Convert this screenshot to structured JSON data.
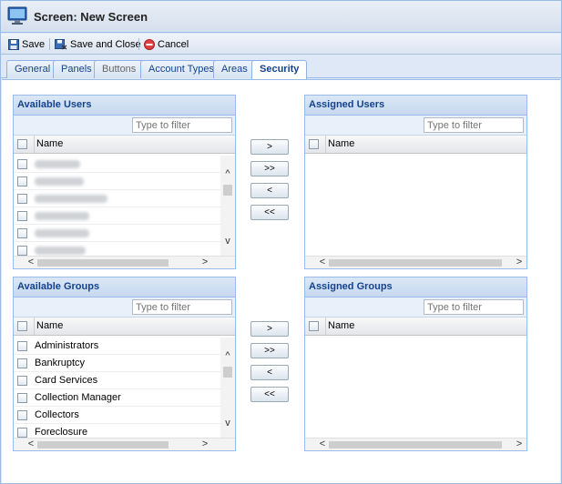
{
  "window": {
    "title": "Screen: New Screen"
  },
  "toolbar": {
    "save": "Save",
    "save_close": "Save and Close",
    "cancel": "Cancel"
  },
  "tabs": [
    {
      "label": "General",
      "state": "normal"
    },
    {
      "label": "Panels",
      "state": "normal"
    },
    {
      "label": "Buttons",
      "state": "disabled"
    },
    {
      "label": "Account Types",
      "state": "normal"
    },
    {
      "label": "Areas",
      "state": "normal"
    },
    {
      "label": "Security",
      "state": "active"
    }
  ],
  "available_users": {
    "title": "Available Users",
    "filter_placeholder": "Type to filter",
    "col_name": "Name"
  },
  "assigned_users": {
    "title": "Assigned Users",
    "filter_placeholder": "Type to filter",
    "col_name": "Name"
  },
  "available_groups": {
    "title": "Available Groups",
    "filter_placeholder": "Type to filter",
    "col_name": "Name",
    "rows": [
      "Administrators",
      "Bankruptcy",
      "Card Services",
      "Collection Manager",
      "Collectors",
      "Foreclosure"
    ]
  },
  "assigned_groups": {
    "title": "Assigned Groups",
    "filter_placeholder": "Type to filter",
    "col_name": "Name"
  },
  "move_buttons": {
    "add": ">",
    "add_all": ">>",
    "remove": "<",
    "remove_all": "<<"
  },
  "scroll": {
    "up": "^",
    "down": "v",
    "left": "<",
    "right": ">"
  }
}
